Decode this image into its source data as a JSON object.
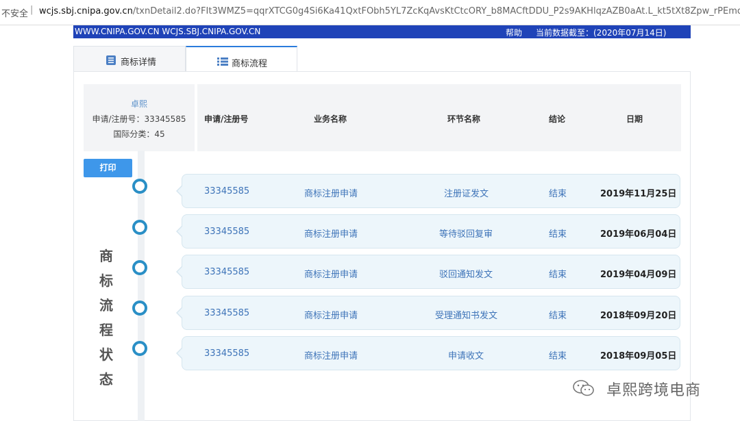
{
  "browser": {
    "security_label": "不安全",
    "separator": "|",
    "host": "wcjs.sbj.cnipa.gov.cn",
    "path": "/txnDetail2.do?FIt3WMZ5=qqrXTCG0g4Si6Ka41QxtFObh5YL7ZcKqAvsKtCtcORY_b8MACftDDU_P2s9AKHlqzAZB0aAt.L_kt5tXt8Zpw_rPEmoUwTMQxbzc"
  },
  "banner": {
    "site": "WWW.CNIPA.GOV.CN WCJS.SBJ.CNIPA.GOV.CN",
    "help": "帮助",
    "date_label": "当前数据截至：(2020年07月14日)"
  },
  "tabs": [
    {
      "label": "商标详情",
      "icon": "list-detail-icon"
    },
    {
      "label": "商标流程",
      "icon": "list-bullets-icon",
      "active": true
    }
  ],
  "info": {
    "owner": "卓熙",
    "reg_no": "申请/注册号：33345585",
    "intl_class": "国际分类：45"
  },
  "columns": {
    "no": "申请/注册号",
    "business": "业务名称",
    "step": "环节名称",
    "result": "结论",
    "date": "日期"
  },
  "print_label": "打印",
  "timeline_title": [
    "商",
    "标",
    "流",
    "程",
    "状",
    "态"
  ],
  "rows": [
    {
      "no": "33345585",
      "business": "商标注册申请",
      "step": "注册证发文",
      "result": "结束",
      "date": "2019年11月25日"
    },
    {
      "no": "33345585",
      "business": "商标注册申请",
      "step": "等待驳回复审",
      "result": "结束",
      "date": "2019年06月04日"
    },
    {
      "no": "33345585",
      "business": "商标注册申请",
      "step": "驳回通知发文",
      "result": "结束",
      "date": "2019年04月09日"
    },
    {
      "no": "33345585",
      "business": "商标注册申请",
      "step": "受理通知书发文",
      "result": "结束",
      "date": "2018年09月20日"
    },
    {
      "no": "33345585",
      "business": "商标注册申请",
      "step": "申请收文",
      "result": "结束",
      "date": "2018年09月05日"
    }
  ],
  "watermark": {
    "text": "卓熙跨境电商",
    "icon": "wechat-icon"
  },
  "colors": {
    "banner": "#1f43b8",
    "accent": "#2a8fc6",
    "button": "#3e97ea",
    "link": "#3d73b8"
  }
}
